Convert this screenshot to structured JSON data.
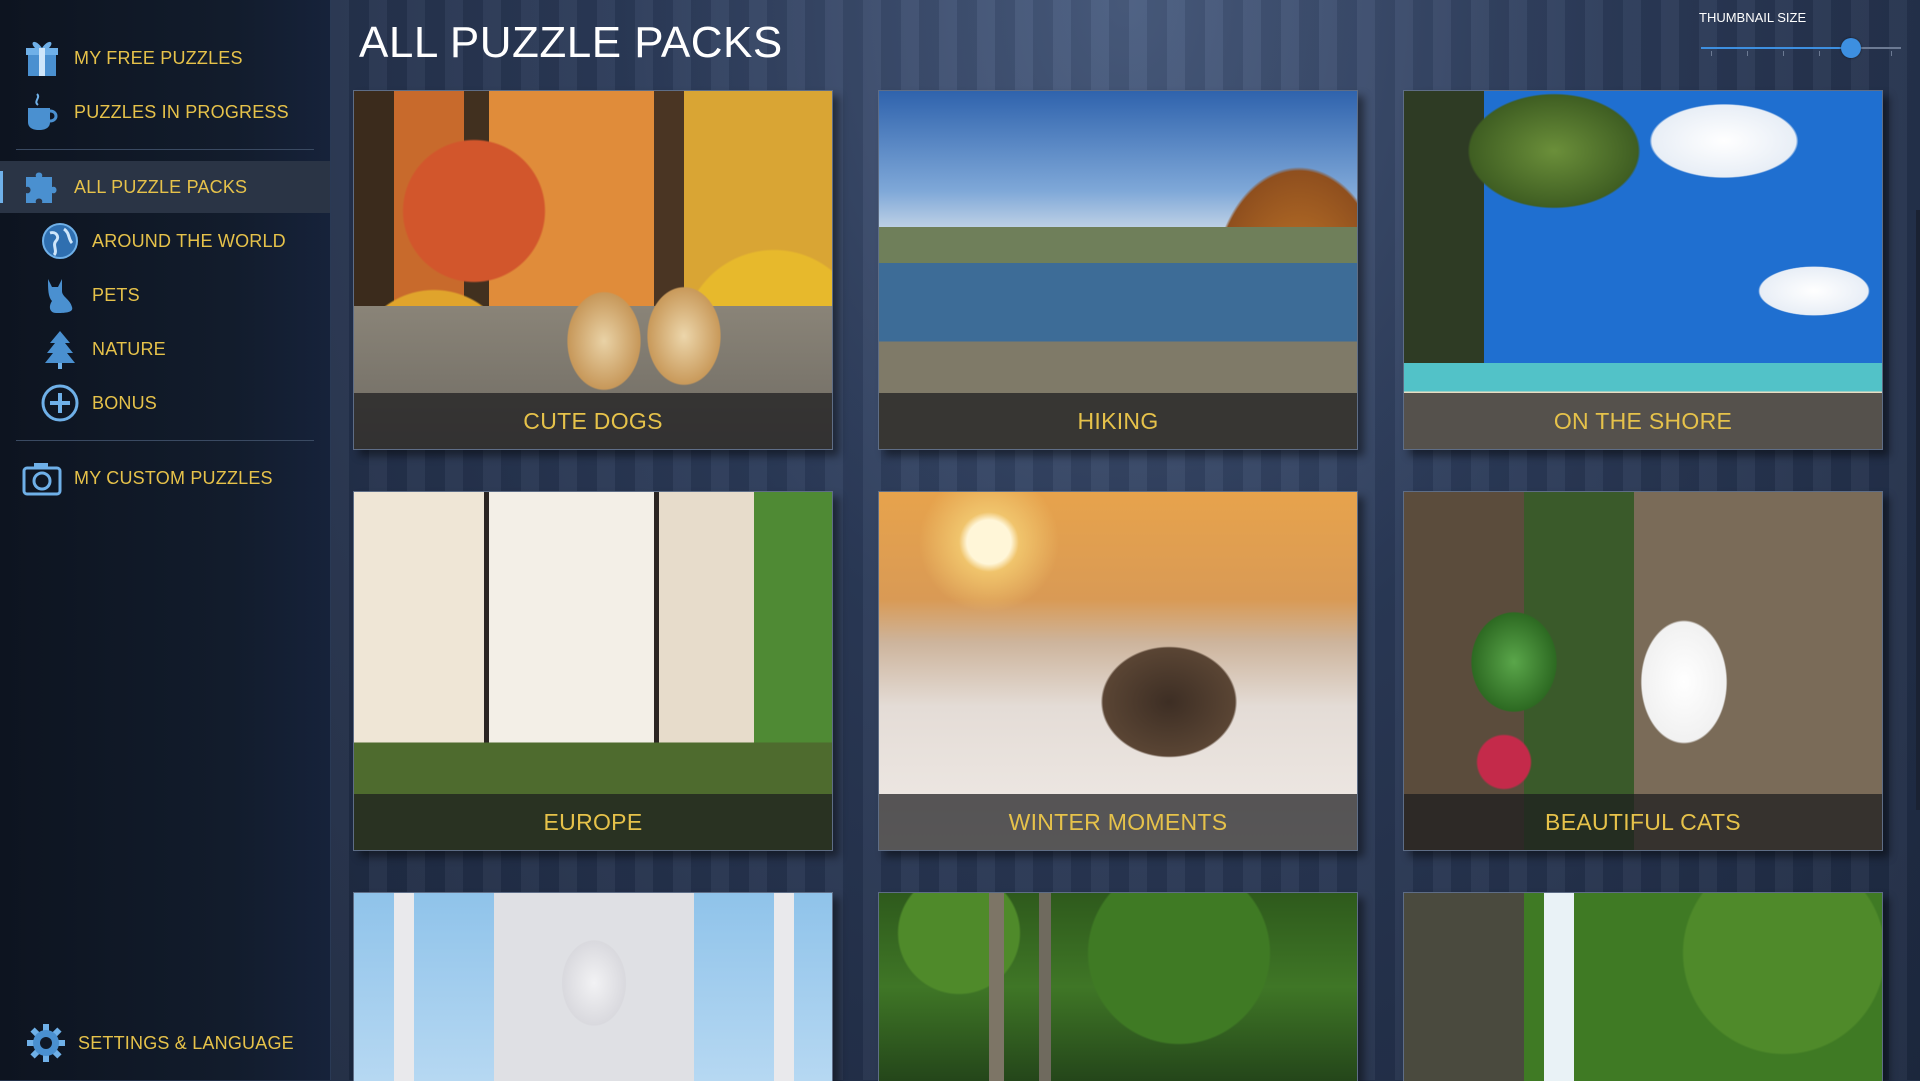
{
  "sidebar": {
    "items": [
      {
        "label": "MY FREE PUZZLES",
        "icon": "gift-icon"
      },
      {
        "label": "PUZZLES IN PROGRESS",
        "icon": "coffee-cup-icon"
      },
      {
        "label": "ALL PUZZLE PACKS",
        "icon": "puzzle-piece-icon",
        "active": true
      },
      {
        "label": "AROUND THE WORLD",
        "icon": "globe-icon"
      },
      {
        "label": "PETS",
        "icon": "cat-icon"
      },
      {
        "label": "NATURE",
        "icon": "tree-icon"
      },
      {
        "label": "BONUS",
        "icon": "plus-circle-icon"
      },
      {
        "label": "MY CUSTOM PUZZLES",
        "icon": "camera-icon"
      }
    ],
    "settings_label": "SETTINGS & LANGUAGE",
    "settings_icon": "gear-icon"
  },
  "main": {
    "title": "ALL PUZZLE PACKS",
    "thumbnail_size_label": "THUMBNAIL SIZE",
    "thumbnail_size_value": 0.75
  },
  "packs": [
    {
      "name": "CUTE DOGS"
    },
    {
      "name": "HIKING"
    },
    {
      "name": "ON THE SHORE"
    },
    {
      "name": "EUROPE"
    },
    {
      "name": "WINTER MOMENTS"
    },
    {
      "name": "BEAUTIFUL CATS"
    },
    {
      "name": ""
    },
    {
      "name": ""
    },
    {
      "name": ""
    }
  ],
  "colors": {
    "accent_text": "#e6c24a",
    "slider_accent": "#3d8fe0",
    "icon_blue": "#4a90d0"
  }
}
